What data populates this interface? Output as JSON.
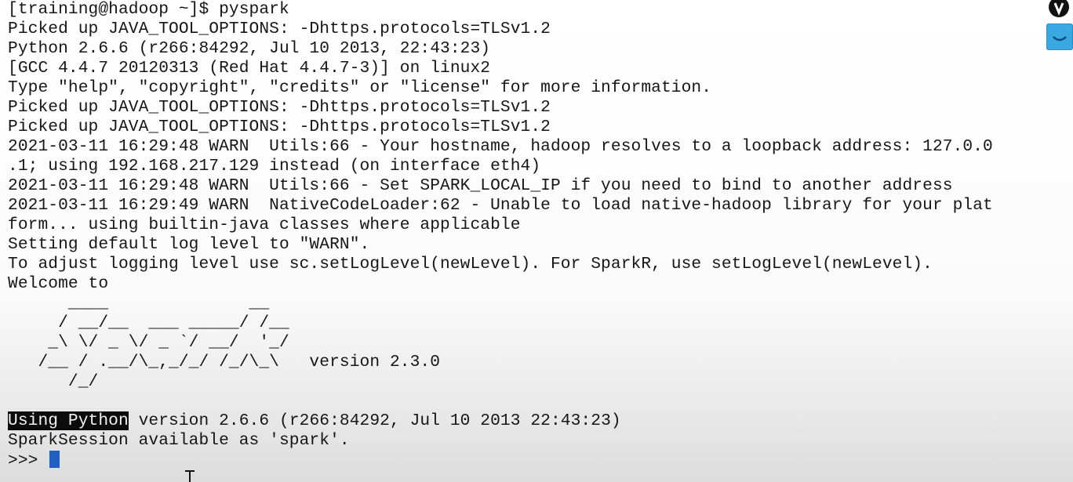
{
  "terminal": {
    "lines": [
      "[training@hadoop ~]$ pyspark",
      "Picked up JAVA_TOOL_OPTIONS: -Dhttps.protocols=TLSv1.2",
      "Python 2.6.6 (r266:84292, Jul 10 2013, 22:43:23)",
      "[GCC 4.4.7 20120313 (Red Hat 4.4.7-3)] on linux2",
      "Type \"help\", \"copyright\", \"credits\" or \"license\" for more information.",
      "Picked up JAVA_TOOL_OPTIONS: -Dhttps.protocols=TLSv1.2",
      "Picked up JAVA_TOOL_OPTIONS: -Dhttps.protocols=TLSv1.2",
      "2021-03-11 16:29:48 WARN  Utils:66 - Your hostname, hadoop resolves to a loopback address: 127.0.0",
      ".1; using 192.168.217.129 instead (on interface eth4)",
      "2021-03-11 16:29:48 WARN  Utils:66 - Set SPARK_LOCAL_IP if you need to bind to another address",
      "2021-03-11 16:29:49 WARN  NativeCodeLoader:62 - Unable to load native-hadoop library for your plat",
      "form... using builtin-java classes where applicable",
      "Setting default log level to \"WARN\".",
      "To adjust logging level use sc.setLogLevel(newLevel). For SparkR, use setLogLevel(newLevel).",
      "Welcome to",
      "      ____              __",
      "     / __/__  ___ _____/ /__",
      "    _\\ \\/ _ \\/ _ `/ __/  '_/",
      "   /__ / .__/\\_,_/_/ /_/\\_\\   version 2.3.0",
      "      /_/",
      "",
      "Using Python version 2.6.6 (r266:84292, Jul 10 2013 22:43:23)",
      "SparkSession available as 'spark'.",
      ">>> "
    ],
    "highlight": {
      "prefix": "Using Python",
      "rest": " version 2.6.6 (r266:84292, Jul 10 2013 22:43:23)"
    },
    "prompt": ">>> "
  }
}
